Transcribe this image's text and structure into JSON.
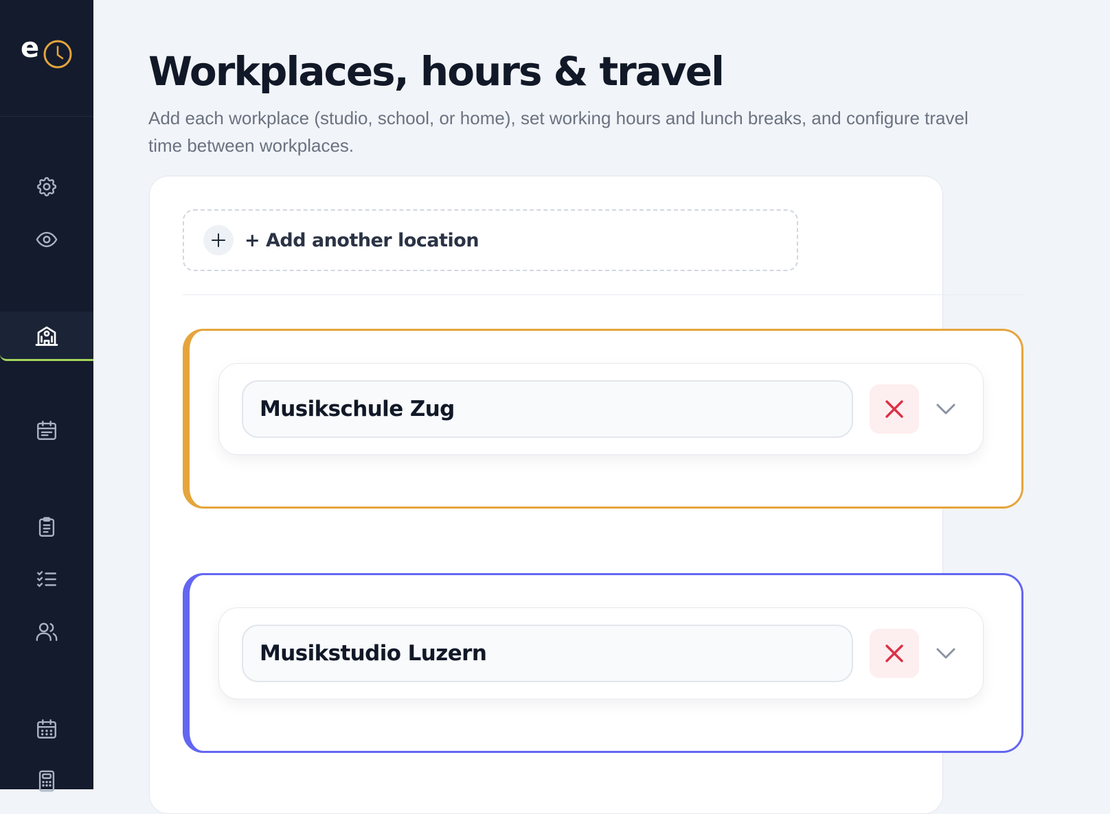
{
  "sidebar": {
    "logo_letter": "e",
    "items": [
      {
        "icon": "gear-icon",
        "active": false
      },
      {
        "icon": "eye-icon",
        "active": false
      },
      {
        "icon": "building-icon",
        "active": true
      },
      {
        "icon": "calendar-list-icon",
        "active": false
      },
      {
        "icon": "clipboard-icon",
        "active": false
      },
      {
        "icon": "checklist-icon",
        "active": false
      },
      {
        "icon": "users-icon",
        "active": false
      },
      {
        "icon": "calendar-grid-icon",
        "active": false
      },
      {
        "icon": "calculator-icon",
        "active": false
      }
    ]
  },
  "header": {
    "title": "Workplaces, hours & travel",
    "description": "Add each workplace (studio, school, or home), set working hours and lunch breaks, and configure travel time between workplaces."
  },
  "add_location": {
    "label": "+ Add another location"
  },
  "locations": [
    {
      "name": "Musikschule Zug",
      "accent_color": "#e5a53c"
    },
    {
      "name": "Musikstudio Luzern",
      "accent_color": "#6366f1"
    }
  ],
  "colors": {
    "sidebar_bg": "#141b2d",
    "active_indicator": "#a3d65c",
    "logo_clock": "#e5a53c",
    "delete_icon": "#dc2f45"
  }
}
